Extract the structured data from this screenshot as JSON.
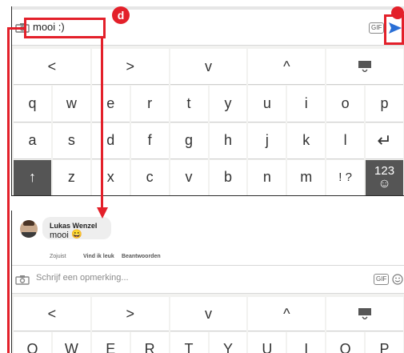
{
  "top": {
    "message_text": "mooi :)",
    "gif_label": "GIF",
    "send_icon": "send-arrow-icon",
    "nav_row": [
      "<",
      ">",
      "v",
      "^",
      "keyboard-hide-icon"
    ],
    "row1": [
      "q",
      "w",
      "e",
      "r",
      "t",
      "y",
      "u",
      "i",
      "o",
      "p"
    ],
    "row2": [
      "a",
      "s",
      "d",
      "f",
      "g",
      "h",
      "j",
      "k",
      "l",
      "↵"
    ],
    "row3_shift": "↑",
    "row3": [
      "z",
      "x",
      "c",
      "v",
      "b",
      "n",
      "m"
    ],
    "row3_punct": "! ?",
    "row3_sym": "123",
    "row3_emoji": "☺"
  },
  "bottom": {
    "comment_author": "Lukas Wenzel",
    "comment_text": "mooi",
    "comment_emoji": "😀",
    "actions": [
      "Zojuist",
      "Vind ik leuk",
      "Beantwoorden"
    ],
    "input_placeholder": "Schrijf een opmerking...",
    "gif_label": "GIF",
    "nav_row": [
      "<",
      ">",
      "v",
      "^",
      "keyboard-hide-icon"
    ],
    "row1": [
      "Q",
      "W",
      "E",
      "R",
      "T",
      "Y",
      "U",
      "I",
      "O",
      "P"
    ]
  },
  "annotation": {
    "badge_label": "d",
    "color": "#e3202a"
  }
}
